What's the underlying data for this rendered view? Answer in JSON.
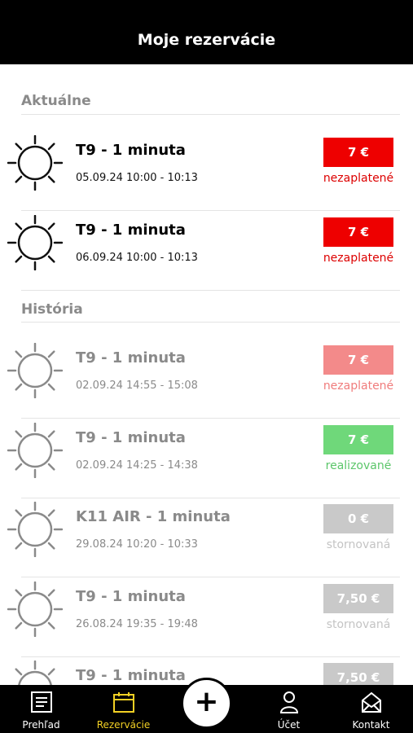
{
  "header": {
    "title": "Moje rezervácie"
  },
  "sections": {
    "current": {
      "title": "Aktuálne",
      "items": [
        {
          "name": "T9 - 1 minuta",
          "time": "05.09.24 10:00 - 10:13",
          "price": "7 €",
          "status": "nezaplatené",
          "price_color": "#ee0000",
          "status_color": "#dd0000",
          "text_color": "#000000",
          "icon_color": "#111111"
        },
        {
          "name": "T9 - 1 minuta",
          "time": "06.09.24 10:00 - 10:13",
          "price": "7 €",
          "status": "nezaplatené",
          "price_color": "#ee0000",
          "status_color": "#dd0000",
          "text_color": "#000000",
          "icon_color": "#111111"
        }
      ]
    },
    "history": {
      "title": "História",
      "items": [
        {
          "name": "T9 - 1 minuta",
          "time": "02.09.24 14:55 - 15:08",
          "price": "7 €",
          "status": "nezaplatené",
          "price_color": "#f38a8a",
          "status_color": "#f07c7c",
          "text_color": "#8a8a8a",
          "icon_color": "#8a8a8a"
        },
        {
          "name": "T9 - 1 minuta",
          "time": "02.09.24 14:25 - 14:38",
          "price": "7 €",
          "status": "realizované",
          "price_color": "#6fd87a",
          "status_color": "#5cc66a",
          "text_color": "#8a8a8a",
          "icon_color": "#8a8a8a"
        },
        {
          "name": "K11 AIR - 1 minuta",
          "time": "29.08.24 10:20 - 10:33",
          "price": "0 €",
          "status": "stornovaná",
          "price_color": "#c9c9c9",
          "status_color": "#c4c4c4",
          "text_color": "#8a8a8a",
          "icon_color": "#8a8a8a"
        },
        {
          "name": "T9 - 1 minuta",
          "time": "26.08.24 19:35 - 19:48",
          "price": "7,50 €",
          "status": "stornovaná",
          "price_color": "#c9c9c9",
          "status_color": "#c4c4c4",
          "text_color": "#8a8a8a",
          "icon_color": "#8a8a8a"
        },
        {
          "name": "T9 - 1 minuta",
          "time": "",
          "price": "7,50 €",
          "status": "",
          "price_color": "#c9c9c9",
          "status_color": "#c4c4c4",
          "text_color": "#8a8a8a",
          "icon_color": "#8a8a8a"
        }
      ]
    }
  },
  "nav": {
    "items": [
      {
        "label": "Prehľad",
        "icon": "document-icon",
        "active": false
      },
      {
        "label": "Rezervácie",
        "icon": "calendar-icon",
        "active": true
      },
      {
        "label": "Účet",
        "icon": "user-icon",
        "active": false
      },
      {
        "label": "Kontakt",
        "icon": "envelope-icon",
        "active": false
      }
    ],
    "add_button": {
      "label": "+",
      "icon": "plus-icon"
    },
    "active_color": "#f2d024"
  }
}
